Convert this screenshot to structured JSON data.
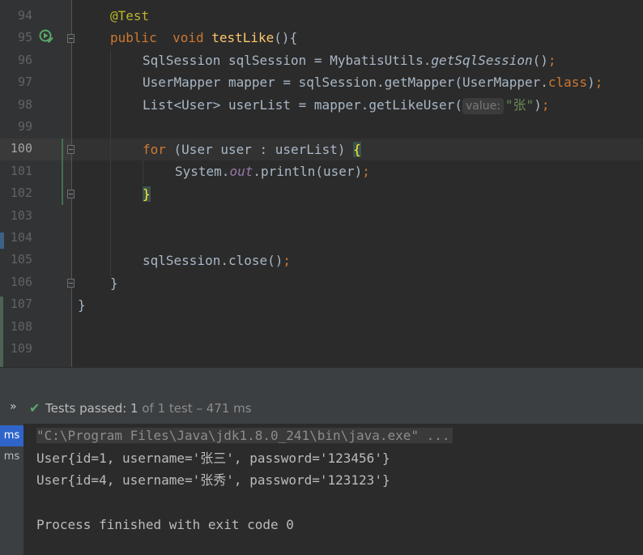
{
  "editor": {
    "lines": [
      {
        "num": "94",
        "current": false
      },
      {
        "num": "95",
        "current": false
      },
      {
        "num": "96",
        "current": false
      },
      {
        "num": "97",
        "current": false
      },
      {
        "num": "98",
        "current": false
      },
      {
        "num": "99",
        "current": false
      },
      {
        "num": "100",
        "current": true
      },
      {
        "num": "101",
        "current": false
      },
      {
        "num": "102",
        "current": false
      },
      {
        "num": "103",
        "current": false
      },
      {
        "num": "104",
        "current": false
      },
      {
        "num": "105",
        "current": false
      },
      {
        "num": "106",
        "current": false
      },
      {
        "num": "107",
        "current": false
      },
      {
        "num": "108",
        "current": false
      },
      {
        "num": "109",
        "current": false
      }
    ],
    "code": {
      "l94": {
        "annotation": "@Test"
      },
      "l95": {
        "kw_public": "public",
        "kw_void": "void",
        "method": "testLike",
        "rest": "(){"
      },
      "l96": {
        "a": "SqlSession sqlSession = MybatisUtils.",
        "call": "getSqlSession",
        "b": "()",
        "semi": ";"
      },
      "l97": {
        "a": "UserMapper mapper = sqlSession.getMapper(UserMapper.",
        "kw_class": "class",
        "b": ")",
        "semi": ";"
      },
      "l98": {
        "a": "List<User> userList = mapper.getLikeUser(",
        "hint": "value:",
        "str": "\"张\"",
        "b": ")",
        "semi": ";"
      },
      "l100": {
        "kw_for": "for",
        "a": " (User user : userList) ",
        "brace": "{"
      },
      "l101": {
        "a": "System.",
        "field": "out",
        "b": ".println(user)",
        "semi": ";"
      },
      "l102": {
        "brace": "}"
      },
      "l105": {
        "a": "sqlSession.close()",
        "semi": ";"
      },
      "l106": {
        "brace": "}"
      },
      "l107": {
        "brace": "}"
      }
    },
    "icons": {
      "run_icon": "run-test-passed-icon",
      "fold_icon": "fold-marker-icon"
    }
  },
  "status": {
    "chevron": "»",
    "check": "✔",
    "prefix": "Tests passed: ",
    "count": "1",
    "rest": " of 1 test – 471 ms"
  },
  "tree": {
    "items": [
      "ms",
      "ms"
    ]
  },
  "console": {
    "command": "\"C:\\Program Files\\Java\\jdk1.8.0_241\\bin\\java.exe\" ...",
    "line1": "User{id=1, username='张三', password='123456'}",
    "line2": "User{id=4, username='张秀', password='123123'}",
    "line3": "Process finished with exit code 0"
  },
  "colors": {
    "keyword": "#cc7832",
    "annotation": "#bbb529",
    "method": "#ffc66d",
    "string": "#6a8759",
    "field": "#9876aa",
    "passed": "#59a869",
    "selection": "#2f65ca"
  }
}
